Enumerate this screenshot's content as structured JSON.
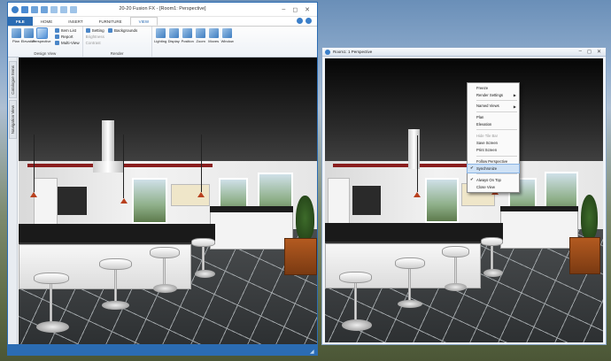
{
  "app": {
    "title": "20-20 Fusion FX - [Room1: Perspective]",
    "window_controls": [
      "–",
      "◻",
      "✕"
    ]
  },
  "ribbon": {
    "tabs": [
      {
        "label": "FILE"
      },
      {
        "label": "HOME"
      },
      {
        "label": "INSERT"
      },
      {
        "label": "FURNITURE"
      },
      {
        "label": "VIEW"
      }
    ],
    "design_view_group": {
      "label": "Design View",
      "buttons": [
        "Plan",
        "Elevation",
        "Perspective"
      ],
      "small": [
        "Item List",
        "Report",
        "Multi-View"
      ]
    },
    "render_group": {
      "label": "Render",
      "small": [
        "Setting",
        "Brightness",
        "Contrast",
        "Backgrounds"
      ]
    },
    "extra_buttons": [
      "Lighting",
      "Display",
      "Position",
      "Zoom",
      "Moves",
      "Window"
    ]
  },
  "side_panel": {
    "tabs": [
      "Catalogue Items",
      "Navigation View"
    ]
  },
  "view_window": {
    "title": "Room1: 1 Perspective",
    "controls": [
      "–",
      "◻",
      "✕"
    ]
  },
  "context_menu": {
    "items": [
      {
        "label": "Freeze",
        "type": "item"
      },
      {
        "label": "Render Settings",
        "type": "submenu"
      },
      {
        "type": "separator"
      },
      {
        "label": "Named Views",
        "type": "submenu"
      },
      {
        "type": "separator"
      },
      {
        "label": "Plan",
        "type": "item"
      },
      {
        "label": "Elevation",
        "type": "item"
      },
      {
        "type": "separator"
      },
      {
        "label": "Hide Tile Bar",
        "type": "disabled"
      },
      {
        "label": "Save Screen",
        "type": "item"
      },
      {
        "label": "Print Screen",
        "type": "item"
      },
      {
        "type": "separator"
      },
      {
        "label": "Follow Perspective",
        "type": "item"
      },
      {
        "label": "Synchronize",
        "type": "checked-highlight"
      },
      {
        "type": "separator"
      },
      {
        "label": "Always On Top",
        "type": "checked"
      },
      {
        "label": "Close View",
        "type": "item"
      }
    ]
  },
  "colors": {
    "accent": "#2b6cb3",
    "file_tab": "#2b6cb3",
    "menu_highlight": "#cfe2f6"
  }
}
